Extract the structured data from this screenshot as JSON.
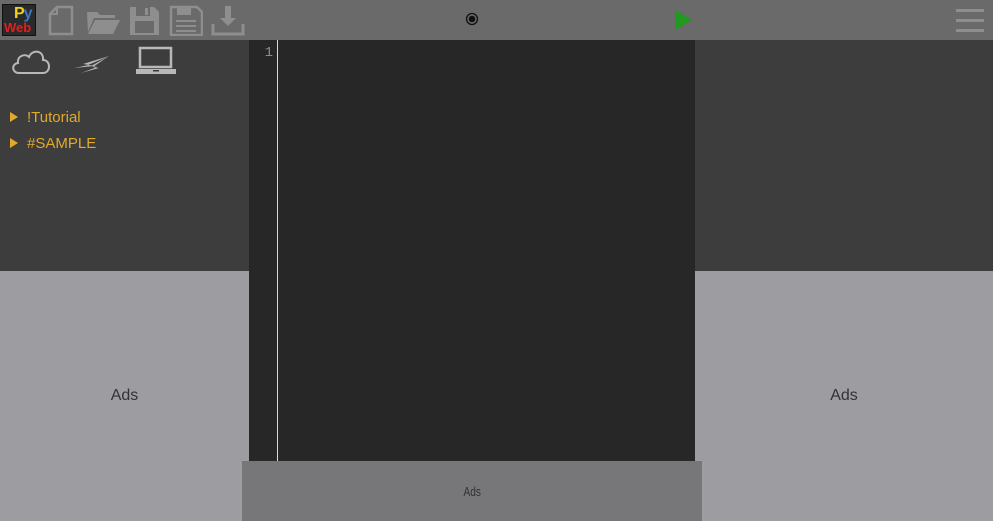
{
  "toolbar": {
    "logo": {
      "py_p": "P",
      "py_y": "y",
      "web": "Web"
    },
    "icons": [
      "new-file-icon",
      "open-folder-icon",
      "save-icon",
      "save-as-icon",
      "download-icon"
    ],
    "center_icon": "record-icon",
    "run_icon": "play-icon",
    "menu_icon": "hamburger-menu-icon",
    "colors": {
      "background": "#6a6a6a",
      "icon": "#8e8e8e",
      "run": "#1f9a1f"
    }
  },
  "left_panel": {
    "mode_icons": [
      "cloud-icon",
      "lightning-icon",
      "laptop-icon"
    ],
    "tree": [
      {
        "label": "!Tutorial"
      },
      {
        "label": "#SAMPLE"
      }
    ],
    "colors": {
      "tree_text": "#e3a92b",
      "background": "#3c3d3c"
    }
  },
  "editor": {
    "line_numbers": [
      "1"
    ],
    "content": ""
  },
  "ads": {
    "left": "Ads",
    "right": "Ads",
    "bottom": "Ads"
  }
}
